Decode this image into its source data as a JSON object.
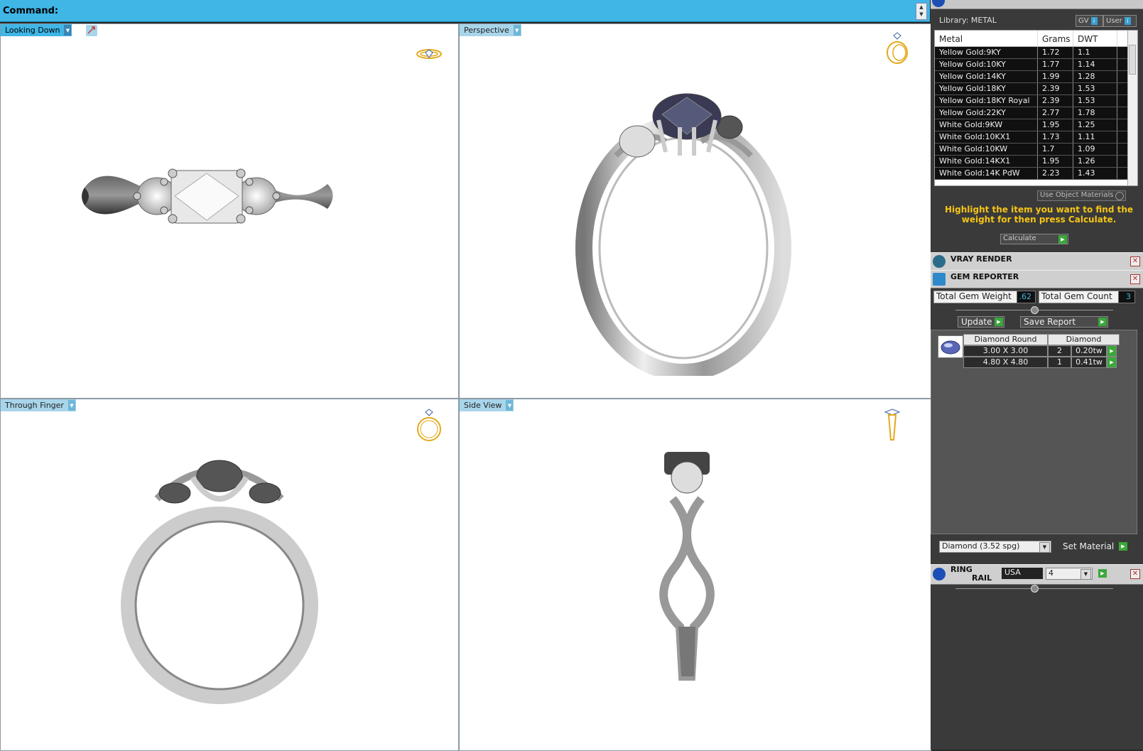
{
  "command": {
    "label": "Command:"
  },
  "viewports": {
    "top_left": {
      "label": "Looking Down"
    },
    "top_right": {
      "label": "Perspective"
    },
    "bottom_left": {
      "label": "Through Finger"
    },
    "bottom_right": {
      "label": "Side View"
    }
  },
  "library": {
    "label": "Library: METAL",
    "gv_label": "GV",
    "user_label": "User",
    "columns": [
      "Metal",
      "Grams",
      "DWT"
    ],
    "rows": [
      [
        "Yellow Gold:9KY",
        "1.72",
        "1.1"
      ],
      [
        "Yellow Gold:10KY",
        "1.77",
        "1.14"
      ],
      [
        "Yellow Gold:14KY",
        "1.99",
        "1.28"
      ],
      [
        "Yellow Gold:18KY",
        "2.39",
        "1.53"
      ],
      [
        "Yellow Gold:18KY Royal",
        "2.39",
        "1.53"
      ],
      [
        "Yellow Gold:22KY",
        "2.77",
        "1.78"
      ],
      [
        "White Gold:9KW",
        "1.95",
        "1.25"
      ],
      [
        "White Gold:10KX1",
        "1.73",
        "1.11"
      ],
      [
        "White Gold:10KW",
        "1.7",
        "1.09"
      ],
      [
        "White Gold:14KX1",
        "1.95",
        "1.26"
      ],
      [
        "White Gold:14K PdW",
        "2.23",
        "1.43"
      ]
    ],
    "use_object_materials": "Use Object Materials",
    "hint": "Highlight the item you want to find the weight for then press Calculate.",
    "calculate": "Calculate"
  },
  "vray": {
    "title": "VRAY RENDER"
  },
  "gem_reporter": {
    "title": "GEM REPORTER",
    "total_weight_label": "Total Gem Weight",
    "total_weight_value": ".62",
    "total_count_label": "Total Gem Count",
    "total_count_value": "3",
    "update": "Update",
    "save_report": "Save Report",
    "headers": [
      "Diamond Round",
      "Diamond"
    ],
    "rows": [
      [
        "3.00 X 3.00",
        "2",
        "0.20tw"
      ],
      [
        "4.80 X 4.80",
        "1",
        "0.41tw"
      ]
    ],
    "material_select": "Diamond     (3.52 spg)",
    "set_material": "Set Material"
  },
  "ring_rail": {
    "title_line1": "RING",
    "title_line2": "RAIL",
    "region": "USA",
    "size": "4"
  },
  "colors": {
    "accent": "#3fb6e6",
    "hint": "#f6c515",
    "go": "#3aa83a"
  }
}
